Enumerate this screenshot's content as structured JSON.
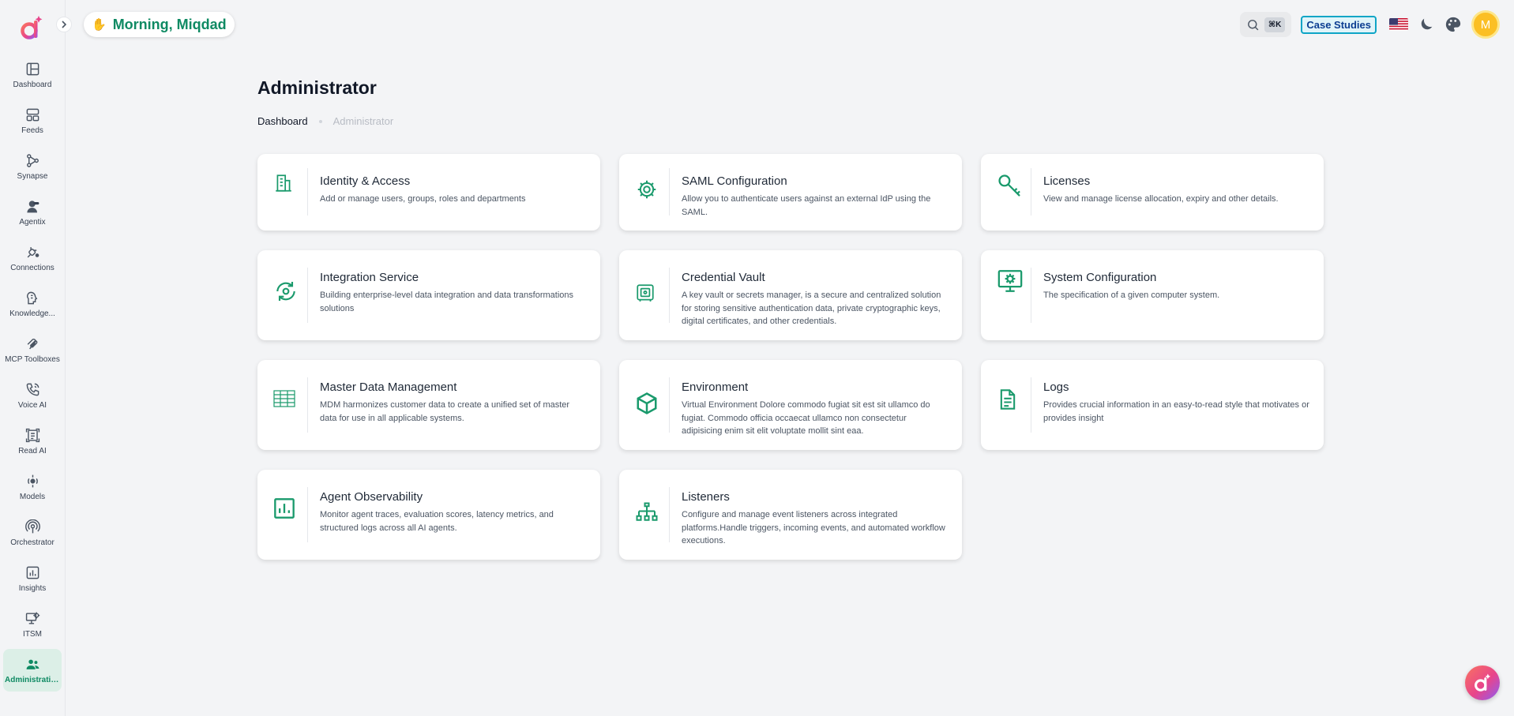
{
  "header": {
    "greeting": "Morning, Miqdad",
    "greeting_emoji": "✋",
    "search_shortcut": "⌘K",
    "case_studies_label": "Case Studies",
    "avatar_initial": "M"
  },
  "sidebar": {
    "items": [
      {
        "label": "Dashboard",
        "icon": "dashboard-icon"
      },
      {
        "label": "Feeds",
        "icon": "feeds-icon"
      },
      {
        "label": "Synapse",
        "icon": "synapse-icon"
      },
      {
        "label": "Agentix",
        "icon": "agentix-icon"
      },
      {
        "label": "Connections",
        "icon": "connections-icon"
      },
      {
        "label": "Knowledge...",
        "icon": "knowledge-icon"
      },
      {
        "label": "MCP Toolboxes",
        "icon": "mcp-icon"
      },
      {
        "label": "Voice AI",
        "icon": "phone-icon"
      },
      {
        "label": "Read AI",
        "icon": "read-ai-icon"
      },
      {
        "label": "Models",
        "icon": "models-icon"
      },
      {
        "label": "Orchestrator",
        "icon": "orchestrator-icon"
      },
      {
        "label": "Insights",
        "icon": "insights-icon"
      },
      {
        "label": "ITSM",
        "icon": "itsm-icon"
      },
      {
        "label": "Administration",
        "icon": "users-icon",
        "active": true
      }
    ]
  },
  "page": {
    "title": "Administrator",
    "breadcrumb_home": "Dashboard",
    "breadcrumb_current": "Administrator"
  },
  "cards": [
    {
      "title": "Identity & Access",
      "desc": "Add or manage users, groups, roles and departments",
      "icon": "building-icon"
    },
    {
      "title": "SAML Configuration",
      "desc": "Allow you to authenticate users against an external IdP using the SAML.",
      "icon": "tools-gear-icon"
    },
    {
      "title": "Licenses",
      "desc": "View and manage license allocation, expiry and other details.",
      "icon": "key-icon"
    },
    {
      "title": "Integration Service",
      "desc": "Building enterprise-level data integration and data transformations solutions",
      "icon": "sync-gear-icon"
    },
    {
      "title": "Credential Vault",
      "desc": "A key vault or secrets manager, is a secure and centralized solution for storing sensitive authentication data, private cryptographic keys, digital certificates, and other credentials.",
      "icon": "vault-icon"
    },
    {
      "title": "System Configuration",
      "desc": "The specification of a given computer system.",
      "icon": "monitor-gear-icon"
    },
    {
      "title": "Master Data Management",
      "desc": "MDM harmonizes customer data to create a unified set of master data for use in all applicable systems.",
      "icon": "table-icon"
    },
    {
      "title": "Environment",
      "desc": "Virtual Environment Dolore commodo fugiat sit est sit ullamco do fugiat. Commodo officia occaecat ullamco non consectetur adipisicing enim sit elit voluptate mollit sint eaa.",
      "icon": "cube-icon"
    },
    {
      "title": "Logs",
      "desc": "Provides crucial information in an easy-to-read style that motivates or provides insight",
      "icon": "document-icon"
    },
    {
      "title": "Agent Observability",
      "desc": "Monitor agent traces, evaluation scores, latency metrics, and structured logs across all AI agents.",
      "icon": "bar-chart-icon"
    },
    {
      "title": "Listeners",
      "desc": "Configure and manage event listeners across integrated platforms.Handle triggers, incoming events, and automated workflow executions.",
      "icon": "hierarchy-icon"
    }
  ],
  "colors": {
    "accent": "#0f8a63",
    "icon_green": "#1a9a6c",
    "background": "#f3f4f6"
  }
}
